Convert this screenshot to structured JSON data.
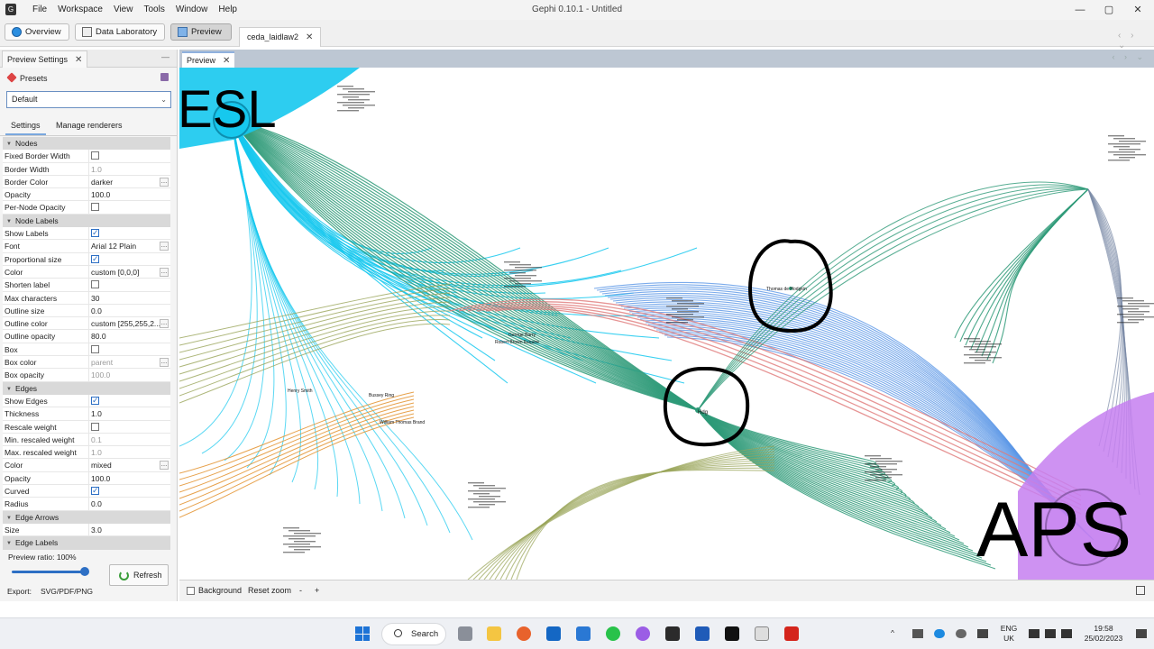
{
  "window": {
    "title": "Gephi 0.10.1 - Untitled",
    "app_icon_glyph": "G",
    "minimize": "—",
    "maximize": "▢",
    "close": "✕"
  },
  "menu": [
    "File",
    "Workspace",
    "View",
    "Tools",
    "Window",
    "Help"
  ],
  "toolbar": {
    "overview": "Overview",
    "data_laboratory": "Data Laboratory",
    "preview": "Preview",
    "file_tab": "ceda_laidlaw2"
  },
  "left_panel": {
    "tab_title": "Preview Settings",
    "minimize": "—",
    "presets_label": "Presets",
    "preset_value": "Default",
    "subtabs": [
      "Settings",
      "Manage renderers"
    ],
    "properties": [
      {
        "kind": "cat",
        "name": "Nodes"
      },
      {
        "kind": "prop",
        "name": "Fixed Border Width",
        "checkbox": false
      },
      {
        "kind": "prop",
        "name": "Border Width",
        "value": "1.0",
        "dim": true
      },
      {
        "kind": "prop",
        "name": "Border Color",
        "value": "darker",
        "dots": true
      },
      {
        "kind": "prop",
        "name": "Opacity",
        "value": "100.0"
      },
      {
        "kind": "prop",
        "name": "Per-Node Opacity",
        "checkbox": false
      },
      {
        "kind": "cat",
        "name": "Node Labels"
      },
      {
        "kind": "prop",
        "name": "Show Labels",
        "checkbox": true
      },
      {
        "kind": "prop",
        "name": "Font",
        "value": "Arial 12 Plain",
        "dots": true
      },
      {
        "kind": "prop",
        "name": "Proportional size",
        "checkbox": true
      },
      {
        "kind": "prop",
        "name": "Color",
        "value": "custom [0,0,0]",
        "dots": true
      },
      {
        "kind": "prop",
        "name": "Shorten label",
        "checkbox": false
      },
      {
        "kind": "prop",
        "name": "Max characters",
        "value": "30"
      },
      {
        "kind": "prop",
        "name": "Outline size",
        "value": "0.0"
      },
      {
        "kind": "prop",
        "name": "Outline color",
        "value": "custom [255,255,2...",
        "dots": true
      },
      {
        "kind": "prop",
        "name": "Outline opacity",
        "value": "80.0"
      },
      {
        "kind": "prop",
        "name": "Box",
        "checkbox": false
      },
      {
        "kind": "prop",
        "name": "Box color",
        "value": "parent",
        "dim": true,
        "dots": true
      },
      {
        "kind": "prop",
        "name": "Box opacity",
        "value": "100.0",
        "dim": true
      },
      {
        "kind": "cat",
        "name": "Edges"
      },
      {
        "kind": "prop",
        "name": "Show Edges",
        "checkbox": true
      },
      {
        "kind": "prop",
        "name": "Thickness",
        "value": "1.0"
      },
      {
        "kind": "prop",
        "name": "Rescale weight",
        "checkbox": false
      },
      {
        "kind": "prop",
        "name": "Min. rescaled weight",
        "value": "0.1",
        "dim": true
      },
      {
        "kind": "prop",
        "name": "Max. rescaled weight",
        "value": "1.0",
        "dim": true
      },
      {
        "kind": "prop",
        "name": "Color",
        "value": "mixed",
        "dots": true
      },
      {
        "kind": "prop",
        "name": "Opacity",
        "value": "100.0"
      },
      {
        "kind": "prop",
        "name": "Curved",
        "checkbox": true
      },
      {
        "kind": "prop",
        "name": "Radius",
        "value": "0.0"
      },
      {
        "kind": "cat",
        "name": "Edge Arrows"
      },
      {
        "kind": "prop",
        "name": "Size",
        "value": "3.0"
      },
      {
        "kind": "cat",
        "name": "Edge Labels"
      }
    ],
    "preview_ratio": "Preview ratio:  100%",
    "preview_ratio_value": 1.0,
    "refresh": "Refresh",
    "export_label": "Export:",
    "export_formats": "SVG/PDF/PNG"
  },
  "preview": {
    "tab_title": "Preview",
    "graph_labels": {
      "esl": "ESL",
      "aps": "APS",
      "node_circled_1": "Thomas de Hodgkin",
      "node_circled_2": "Hdg",
      "node_a": "Henry Smith",
      "node_b": "Bussey Ring",
      "node_c": "William Thomas Brand",
      "node_d": "George Barry",
      "node_e": "Robert Brown Esquire"
    },
    "background_label": "Background",
    "reset_zoom": "Reset zoom",
    "zoom_out": "-",
    "zoom_in": "+"
  },
  "taskbar": {
    "search": "Search",
    "lang_top": "ENG",
    "lang_bottom": "UK",
    "time": "19:58",
    "date": "25/02/2023",
    "caret": "^"
  },
  "colors": {
    "esl_cyan": "#16c8ee",
    "aps_purple": "#c67ff0",
    "teal": "#2e9a78",
    "blue": "#5a96e6",
    "red": "#e07a7a",
    "olive": "#9aa55a",
    "orange": "#e3922e"
  }
}
